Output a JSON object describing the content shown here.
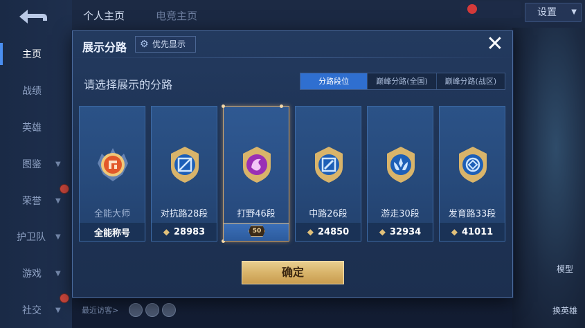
{
  "sidebar": {
    "back_icon": "back-arrow-icon",
    "items": [
      {
        "label": "主页",
        "active": true,
        "chevron": false,
        "dot": false
      },
      {
        "label": "战绩",
        "active": false,
        "chevron": false,
        "dot": false
      },
      {
        "label": "英雄",
        "active": false,
        "chevron": false,
        "dot": false
      },
      {
        "label": "图鉴",
        "active": false,
        "chevron": true,
        "dot": false
      },
      {
        "label": "荣誉",
        "active": false,
        "chevron": true,
        "dot": true
      },
      {
        "label": "护卫队",
        "active": false,
        "chevron": true,
        "dot": false
      },
      {
        "label": "游戏",
        "active": false,
        "chevron": true,
        "dot": false
      },
      {
        "label": "社交",
        "active": false,
        "chevron": true,
        "dot": true
      }
    ]
  },
  "header": {
    "tabs": [
      "个人主页",
      "电竞主页"
    ],
    "settings_label": "设置"
  },
  "right_panel": {
    "model_label": "模型",
    "change_hero_label": "换英雄"
  },
  "footer": {
    "recent_visitors_label": "最近访客>"
  },
  "modal": {
    "title": "展示分路",
    "priority_label": "优先显示",
    "close_icon": "close-icon",
    "subtitle": "请选择展示的分路",
    "tabs": [
      {
        "label": "分路段位",
        "active": true
      },
      {
        "label": "巅峰分路(全国)",
        "active": false
      },
      {
        "label": "巅峰分路(战区)",
        "active": false
      }
    ],
    "cards": [
      {
        "label": "全能大师",
        "value": "全能称号",
        "selected": false,
        "emblem_color": "#e2582a",
        "icon": "all-round-master-emblem-icon"
      },
      {
        "label": "对抗路28段",
        "value": "28983",
        "selected": false,
        "emblem_color": "#2a8ef0",
        "icon": "clash-lane-emblem-icon"
      },
      {
        "label": "打野46段",
        "value": "",
        "selected": true,
        "level": "50",
        "emblem_color": "#b43ac8",
        "icon": "jungle-emblem-icon"
      },
      {
        "label": "中路26段",
        "value": "24850",
        "selected": false,
        "emblem_color": "#2a8ef0",
        "icon": "mid-lane-emblem-icon"
      },
      {
        "label": "游走30段",
        "value": "32934",
        "selected": false,
        "emblem_color": "#2a8ef0",
        "icon": "roam-emblem-icon"
      },
      {
        "label": "发育路33段",
        "value": "41011",
        "selected": false,
        "emblem_color": "#2a8ef0",
        "icon": "farm-lane-emblem-icon"
      }
    ],
    "confirm_label": "确定"
  },
  "colors": {
    "accent_blue": "#2f6fd0",
    "gold": "#d9b46a",
    "selected_border": "#d8a868"
  }
}
